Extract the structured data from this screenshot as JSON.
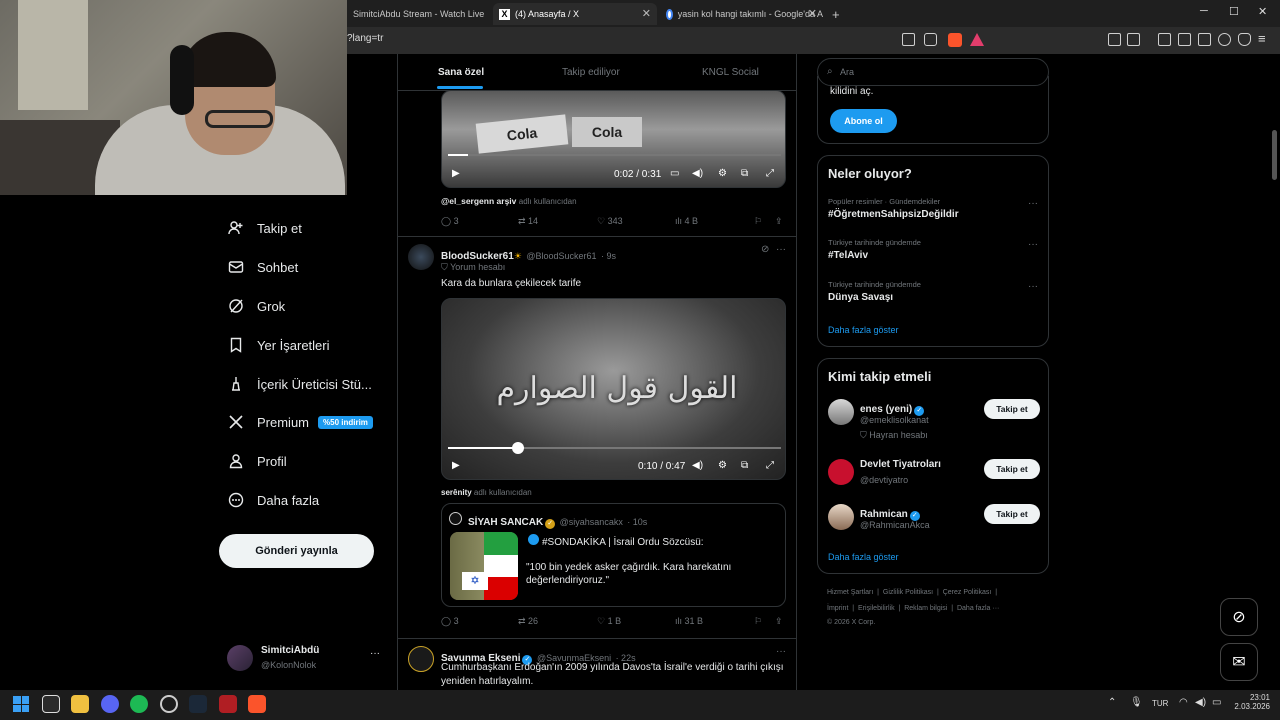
{
  "browser": {
    "tabs": [
      {
        "label": "SimitciAbdu Stream - Watch Live on"
      },
      {
        "label": "(4) Anasayfa / X"
      },
      {
        "label": "yasin kol hangi takımlı - Google'da A"
      }
    ],
    "new_tab": "+",
    "url": "?lang=tr",
    "controls": {
      "minimize": "─",
      "maximize": "☐",
      "close": "✕"
    }
  },
  "sidebar": {
    "items": [
      {
        "label": "Takip et",
        "icon": "add-person-icon"
      },
      {
        "label": "Sohbet",
        "icon": "mail-icon"
      },
      {
        "label": "Grok",
        "icon": "grok-icon"
      },
      {
        "label": "Yer İşaretleri",
        "icon": "bookmark-icon"
      },
      {
        "label": "İçerik Üreticisi Stü...",
        "icon": "creator-icon"
      },
      {
        "label": "Premium",
        "icon": "x-logo-icon",
        "badge": "%50 indirim"
      },
      {
        "label": "Profil",
        "icon": "person-icon"
      },
      {
        "label": "Daha fazla",
        "icon": "more-circle-icon"
      }
    ],
    "post_button": "Gönderi yayınla",
    "account": {
      "name": "SimitciAbdü",
      "handle": "@KolonNolok",
      "more": "···"
    }
  },
  "feed": {
    "tabs": [
      "Sana özel",
      "Takip ediliyor",
      "KNGL Social"
    ],
    "post1": {
      "video_time": "0:02 / 0:31",
      "progress": 0.06,
      "user_line_name": "@el_sergenn arşiv",
      "user_line_suffix": "adlı kullanıcıdan",
      "replies": "3",
      "reposts": "14",
      "likes": "343",
      "views": "4 B"
    },
    "post2": {
      "name": "BloodSucker61",
      "handle": "@BloodSucker61",
      "time": "· 9s",
      "subtitle": "Yorum hesabı",
      "text": "Kara da bunlara çekilecek tarife",
      "video_text": "القول قول الصوارم",
      "video_time": "0:10 / 0:47",
      "progress": 0.21,
      "user_line_name": "serênity",
      "user_line_suffix": "adlı kullanıcıdan",
      "quote": {
        "name": "SİYAH SANCAK",
        "handle": "@siyahsancakx",
        "time": "· 10s",
        "line1": "#SONDAKİKA | İsrail Ordu Sözcüsü:",
        "line2": "\"100 bin yedek asker çağırdık. Kara harekatını değerlendiriyoruz.\""
      },
      "replies": "3",
      "reposts": "26",
      "likes": "1 B",
      "views": "31 B"
    },
    "post3": {
      "name": "Savunma Ekseni",
      "handle": "@SavunmaEkseni",
      "time": "· 22s",
      "text1": "Cumhurbaşkanı Erdoğan'ın 2009 yılında Davos'ta İsrail'e verdiği o tarihi çıkışı",
      "text2": "yeniden hatırlayalım."
    }
  },
  "right": {
    "search_placeholder": "Ara",
    "premium_text": "kilidini aç.",
    "subscribe": "Abone ol",
    "trends_title": "Neler oluyor?",
    "trends": [
      {
        "category": "Popüler resimler · Gündemdekiler",
        "title": "#ÖğretmenSahipsizDeğildir"
      },
      {
        "category": "Türkiye tarihinde gündemde",
        "title": "#TelAviv"
      },
      {
        "category": "Türkiye tarihinde gündemde",
        "title": "Dünya Savaşı"
      }
    ],
    "show_more": "Daha fazla göster",
    "who_title": "Kimi takip etmeli",
    "who": [
      {
        "name": "enes (yeni)",
        "handle": "@emeklisolkanat",
        "sub": "Hayran hesabı",
        "button": "Takip et"
      },
      {
        "name": "Devlet Tiyatroları",
        "handle": "@devtiyatro",
        "button": "Takip et"
      },
      {
        "name": "Rahmican",
        "handle": "@RahmicanAkca",
        "button": "Takip et"
      }
    ],
    "footer": [
      "Hizmet Şartları",
      "Gizlilik Politikası",
      "Çerez Politikası",
      "İmprint",
      "Erişilebilirlik",
      "Reklam bilgisi",
      "Daha fazla ···",
      "© 2026 X Corp."
    ]
  },
  "taskbar": {
    "lang": "TUR",
    "time": "23:01",
    "date": "2.03.2026"
  }
}
